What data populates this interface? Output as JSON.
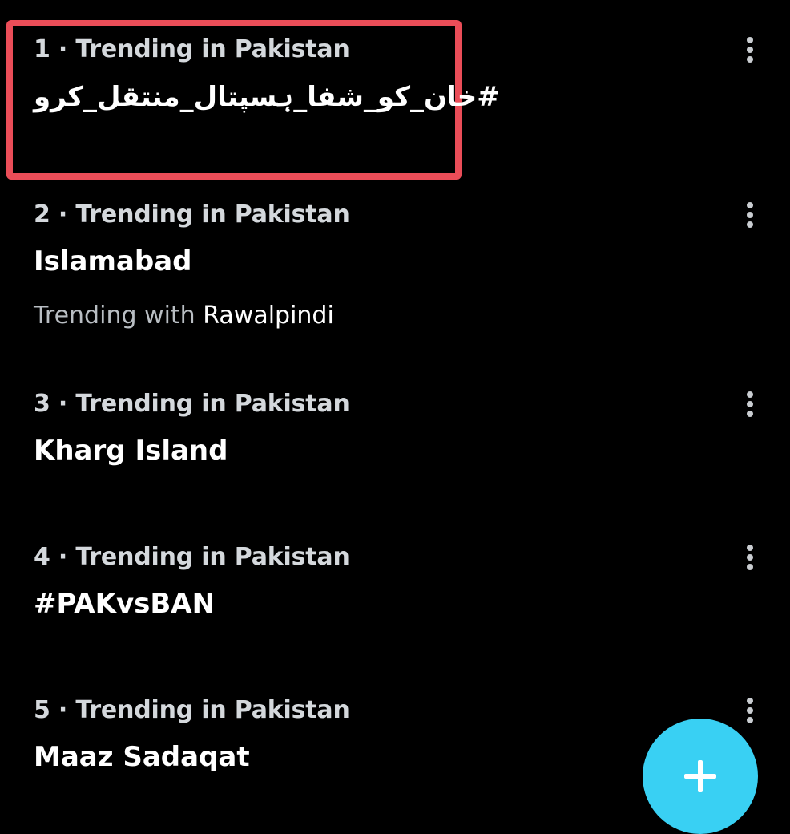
{
  "trends": [
    {
      "rank_header": "1 · Trending in Pakistan",
      "title": "#خان_کو_شفا_ہسپتال_منتقل_کرو",
      "context_prefix": "",
      "context_name": ""
    },
    {
      "rank_header": "2 · Trending in Pakistan",
      "title": "Islamabad",
      "context_prefix": "Trending with ",
      "context_name": "Rawalpindi"
    },
    {
      "rank_header": "3 · Trending in Pakistan",
      "title": "Kharg Island",
      "context_prefix": "",
      "context_name": ""
    },
    {
      "rank_header": "4 · Trending in Pakistan",
      "title": "#PAKvsBAN",
      "context_prefix": "",
      "context_name": ""
    },
    {
      "rank_header": "5 · Trending in Pakistan",
      "title": "Maaz Sadaqat",
      "context_prefix": "",
      "context_name": ""
    }
  ],
  "icons": {
    "more": "more-vertical-icon",
    "compose": "plus-icon"
  },
  "colors": {
    "background": "#000000",
    "highlight_border": "#ea4d58",
    "fab": "#39d0f3",
    "header_text": "#d4d8dc",
    "title_text": "#ffffff",
    "context_text": "#b9bec3"
  }
}
